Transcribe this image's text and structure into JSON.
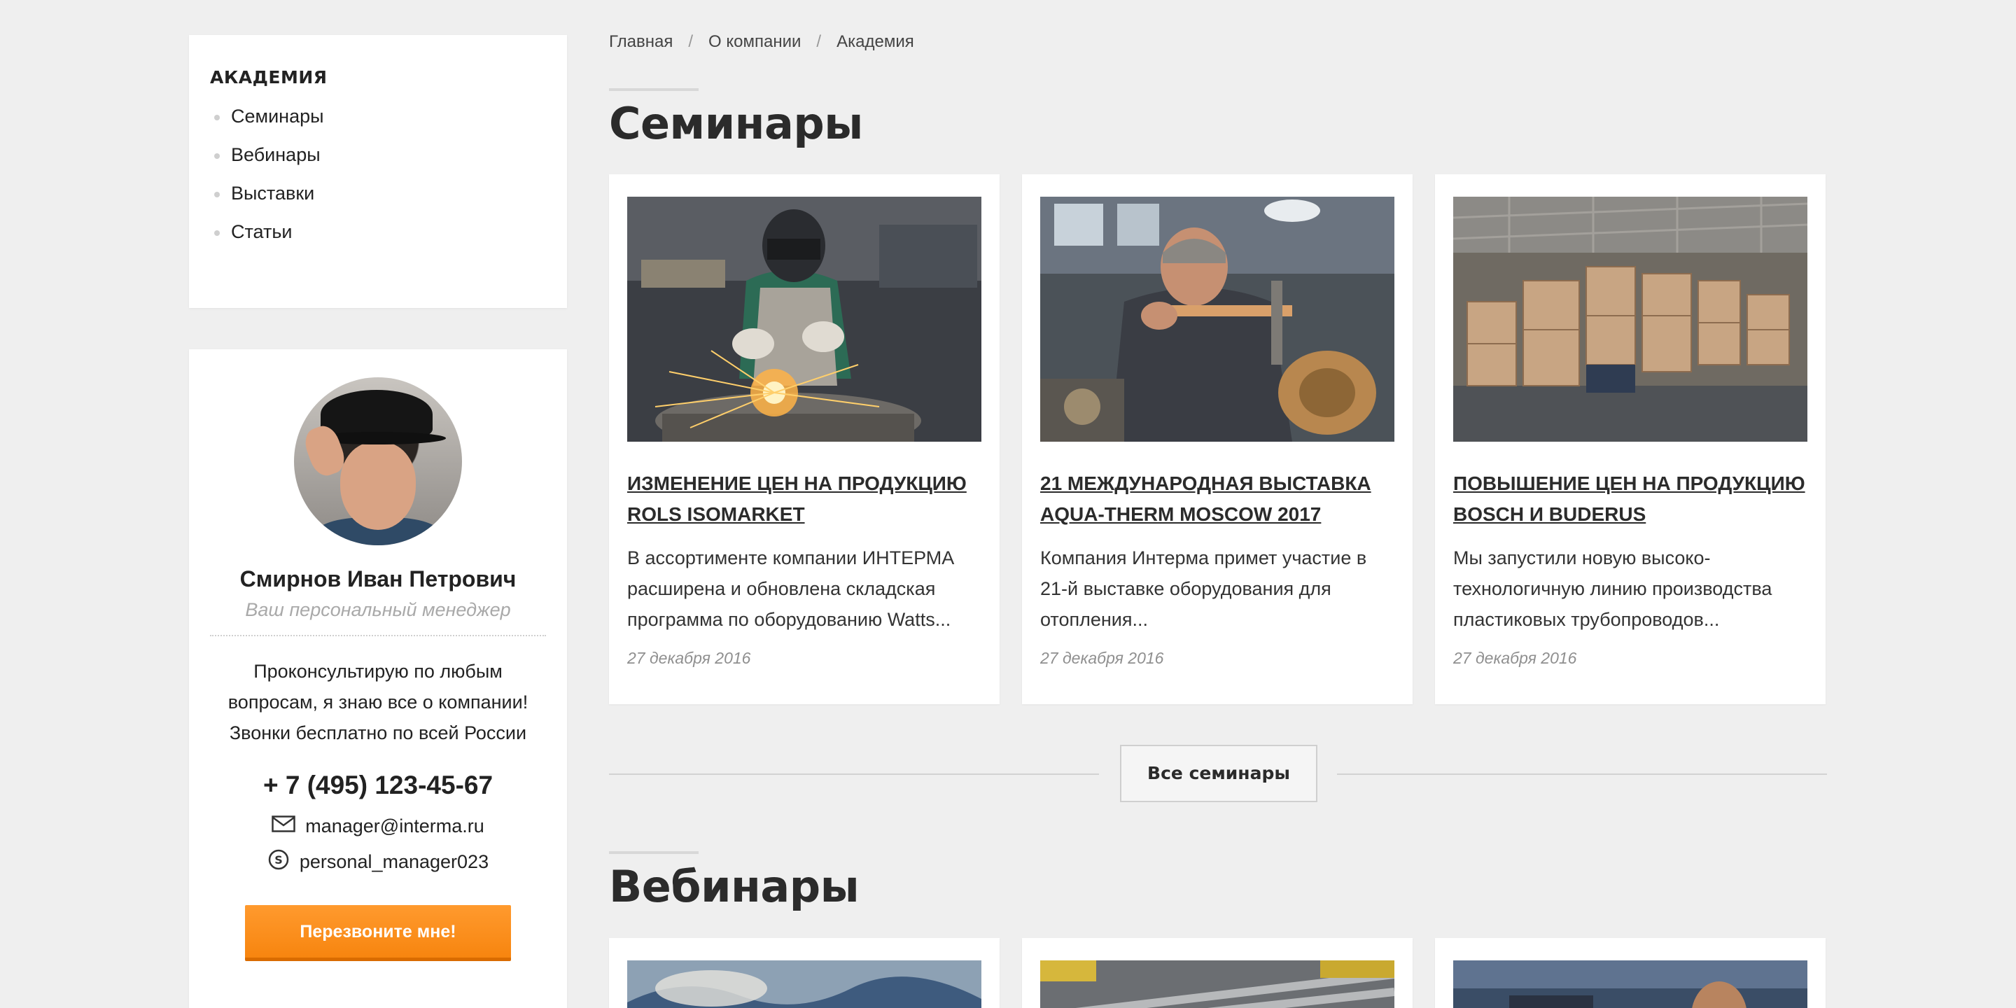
{
  "sidebar": {
    "title": "АКАДЕМИЯ",
    "items": [
      "Семинары",
      "Вебинары",
      "Выставки",
      "Статьи"
    ]
  },
  "manager": {
    "name": "Смирнов Иван Петрович",
    "role": "Ваш персональный менеджер",
    "text": "Проконсультирую по любым вопросам, я знаю все о компании! Звонки бесплатно по всей России",
    "phone": "+ 7 (495) 123-45-67",
    "email": "manager@interma.ru",
    "skype": "personal_manager023",
    "button_label": "Перезвоните мне!"
  },
  "breadcrumb": [
    "Главная",
    "О компании",
    "Академия"
  ],
  "seminars": {
    "title": "Семинары",
    "cards": [
      {
        "title": "ИЗМЕНЕНИЕ ЦЕН НА ПРОДУКЦИЮ ROLS ISOMARKET",
        "text": "В ассортименте компании ИНТЕРМА расширена и обновлена складская программа по оборудованию Watts...",
        "date": "27 декабря 2016",
        "image": "welder-sparks-photo"
      },
      {
        "title": "21 МЕЖДУНАРОДНАЯ ВЫСТАВКА AQUA-THERM MOSCOW 2017",
        "text": "Компания Интерма примет участие в 21-й выставке оборудования для отопления...",
        "date": "27 декабря 2016",
        "image": "lathe-worker-photo"
      },
      {
        "title": "ПОВЫШЕНИЕ ЦЕН НА ПРОДУКЦИЮ BOSCH И BUDERUS",
        "text": "Мы запустили новую высоко-технологичную линию производства пластиковых трубопроводов...",
        "date": "27 декабря 2016",
        "image": "warehouse-boxes-photo"
      }
    ],
    "all_label": "Все семинары"
  },
  "webinars": {
    "title": "Вебинары"
  },
  "colors": {
    "accent": "#f7850f",
    "background": "#efefef"
  }
}
